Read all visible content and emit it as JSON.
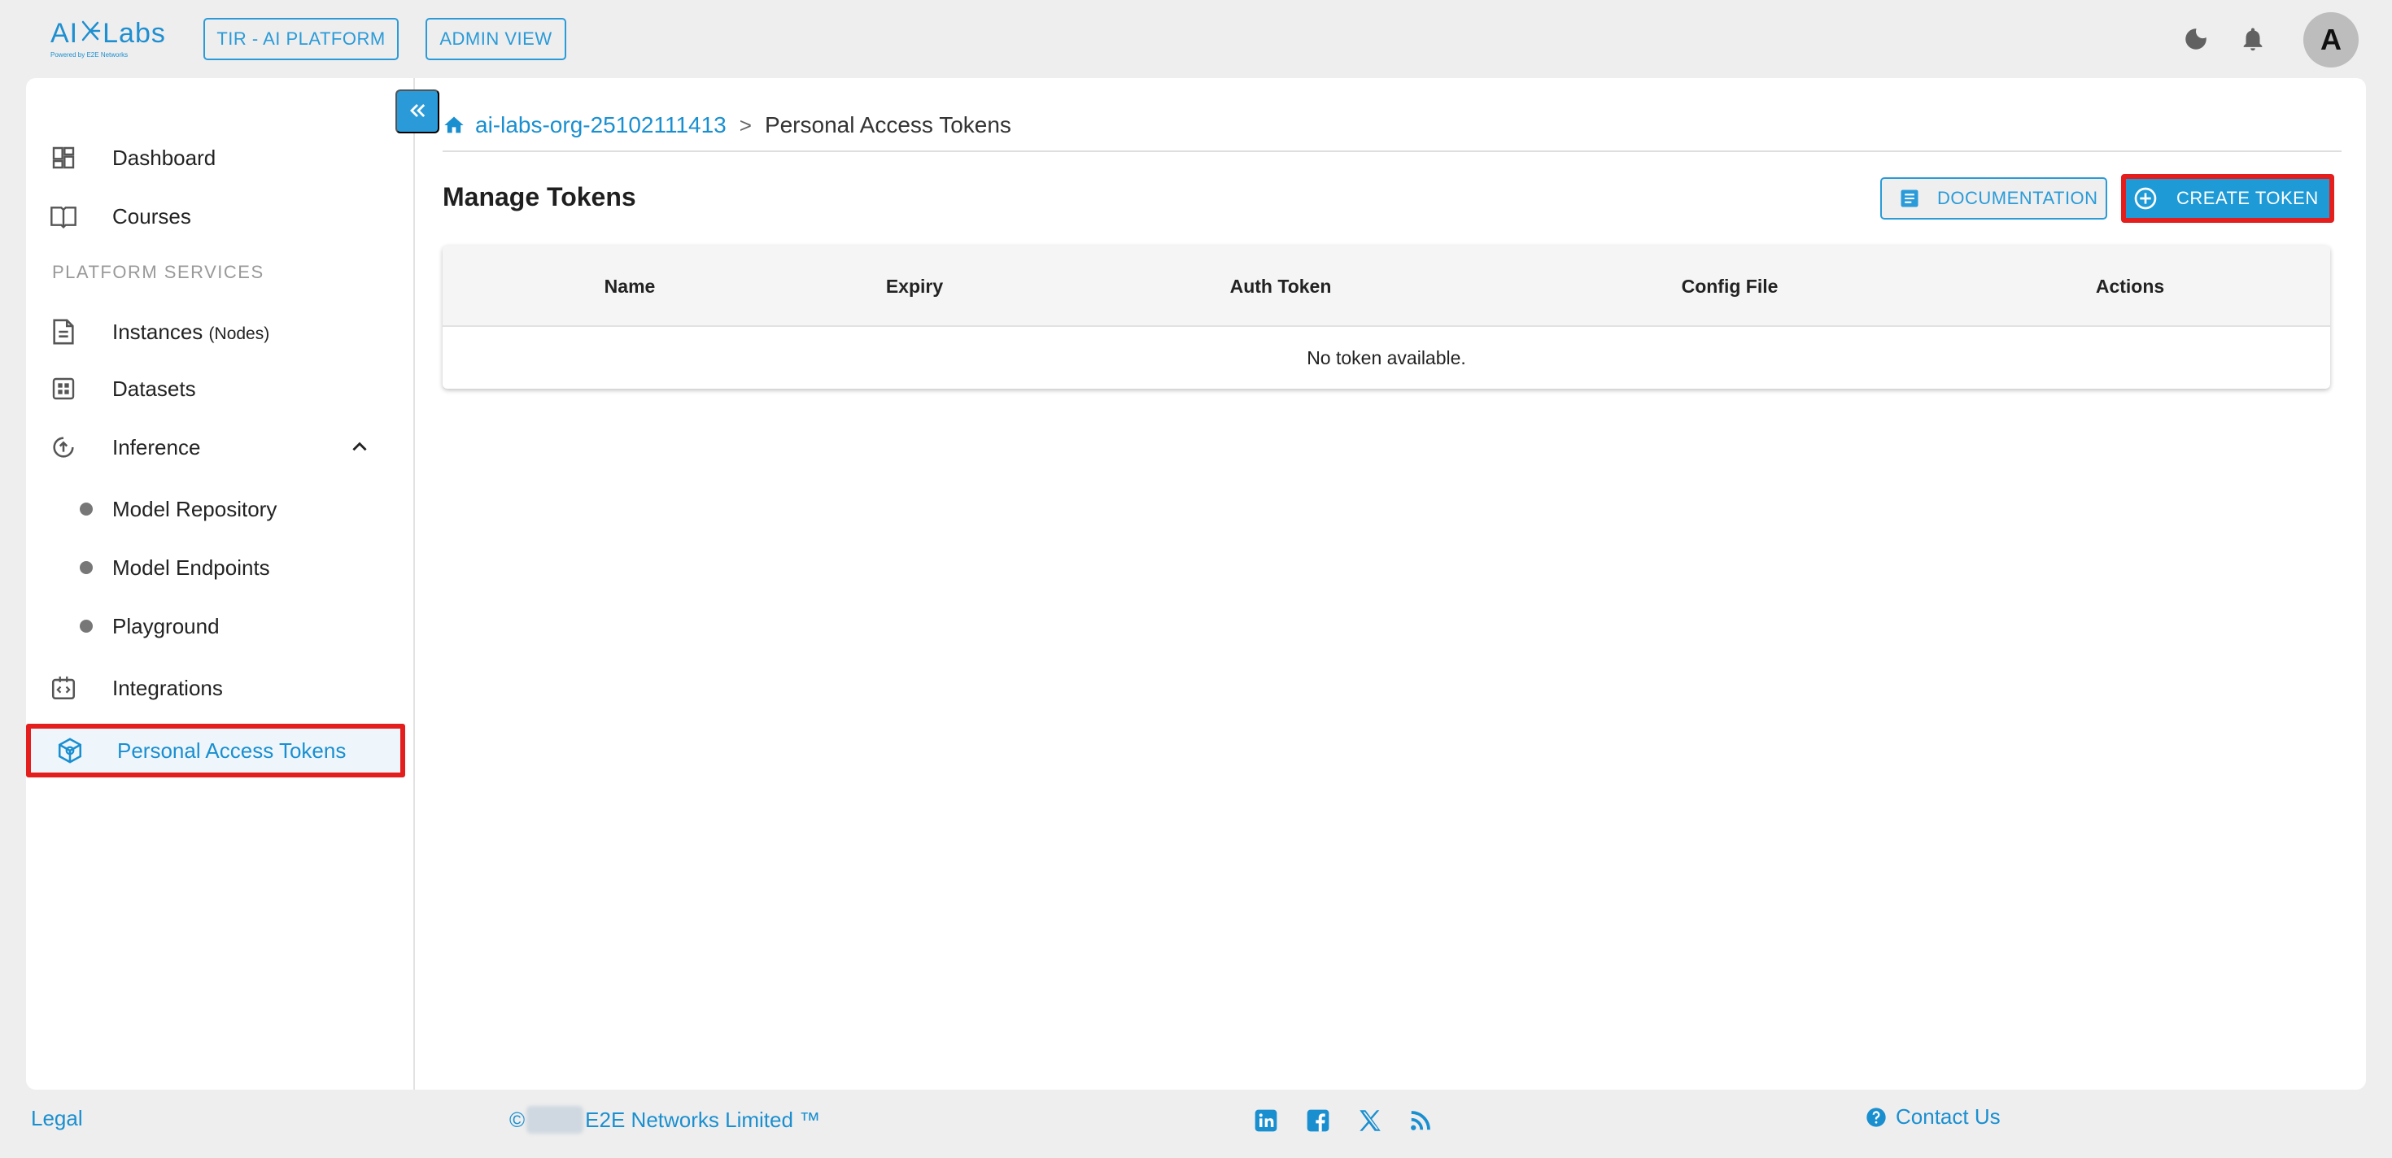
{
  "header": {
    "logo_text_left": "AI",
    "logo_text_right": "Labs",
    "logo_tagline": "Powered by E2E Networks",
    "platform_button": "TIR - AI PLATFORM",
    "admin_button": "ADMIN VIEW",
    "avatar_initial": "A"
  },
  "sidebar": {
    "items": [
      {
        "label": "Dashboard"
      },
      {
        "label": "Courses"
      }
    ],
    "section_title": "PLATFORM SERVICES",
    "services": {
      "instances": {
        "label": "Instances",
        "suffix": "(Nodes)"
      },
      "datasets": {
        "label": "Datasets"
      },
      "inference": {
        "label": "Inference"
      },
      "model_repository": {
        "label": "Model Repository"
      },
      "model_endpoints": {
        "label": "Model Endpoints"
      },
      "playground": {
        "label": "Playground"
      },
      "integrations": {
        "label": "Integrations"
      },
      "tokens": {
        "label": "Personal Access Tokens"
      }
    }
  },
  "breadcrumb": {
    "org": "ai-labs-org-25102111413",
    "separator": ">",
    "page": "Personal Access Tokens"
  },
  "main": {
    "title": "Manage Tokens",
    "documentation_button": "DOCUMENTATION",
    "create_button": "CREATE TOKEN",
    "table": {
      "columns": [
        "Name",
        "Expiry",
        "Auth Token",
        "Config File",
        "Actions"
      ],
      "empty_message": "No token available."
    }
  },
  "footer": {
    "legal": "Legal",
    "copyright_symbol": "©",
    "company": "E2E Networks Limited ™",
    "contact": "Contact Us"
  },
  "colors": {
    "accent": "#1e9ad6",
    "highlight": "#e41d1d",
    "active_bg": "#eef6fc"
  },
  "icons": [
    "moon-icon",
    "bell-icon",
    "dashboard-icon",
    "book-icon",
    "document-icon",
    "dataset-icon",
    "inference-icon",
    "chevron-up-icon",
    "integrations-icon",
    "token-cube-icon",
    "collapse-icon",
    "home-icon",
    "documentation-icon",
    "add-circle-icon",
    "linkedin-icon",
    "facebook-icon",
    "x-icon",
    "rss-icon",
    "help-icon"
  ]
}
